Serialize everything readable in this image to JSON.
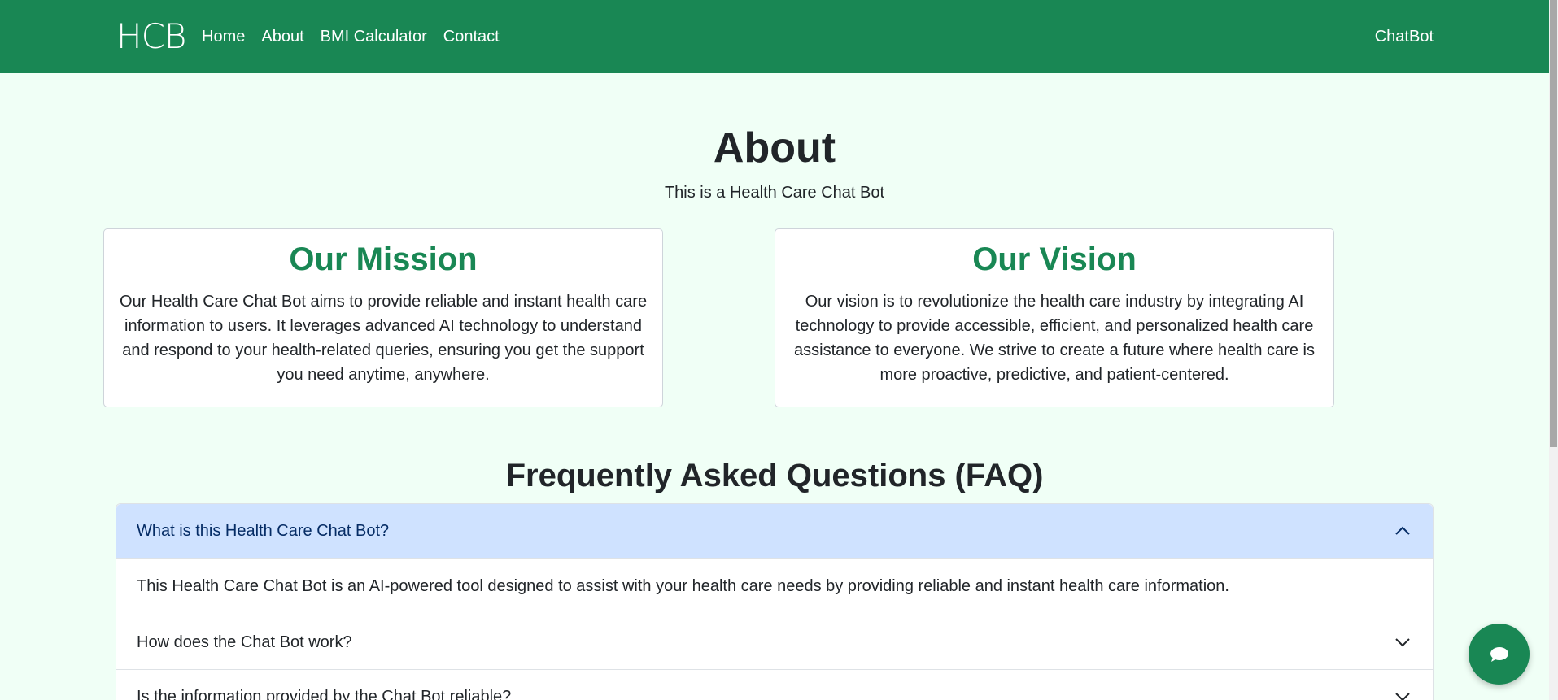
{
  "navbar": {
    "brand": "HCB",
    "links": [
      "Home",
      "About",
      "BMI Calculator",
      "Contact"
    ],
    "right_link": "ChatBot"
  },
  "about": {
    "title": "About",
    "subtitle": "This is a Health Care Chat Bot"
  },
  "cards": {
    "mission": {
      "title": "Our Mission",
      "text": "Our Health Care Chat Bot aims to provide reliable and instant health care information to users. It leverages advanced AI technology to understand and respond to your health-related queries, ensuring you get the support you need anytime, anywhere."
    },
    "vision": {
      "title": "Our Vision",
      "text": "Our vision is to revolutionize the health care industry by integrating AI technology to provide accessible, efficient, and personalized health care assistance to everyone. We strive to create a future where health care is more proactive, predictive, and patient-centered."
    }
  },
  "faq": {
    "title": "Frequently Asked Questions (FAQ)",
    "items": [
      {
        "question": "What is this Health Care Chat Bot?",
        "answer": "This Health Care Chat Bot is an AI-powered tool designed to assist with your health care needs by providing reliable and instant health care information."
      },
      {
        "question": "How does the Chat Bot work?"
      },
      {
        "question": "Is the information provided by the Chat Bot reliable?"
      }
    ]
  },
  "icons": {
    "chat_fab": "chat-bubble-icon",
    "expanded": "chevron-up-icon",
    "collapsed": "chevron-down-icon"
  },
  "colors": {
    "primary": "#198754",
    "background": "#f0fff6",
    "accordion_active": "#cfe2ff"
  }
}
